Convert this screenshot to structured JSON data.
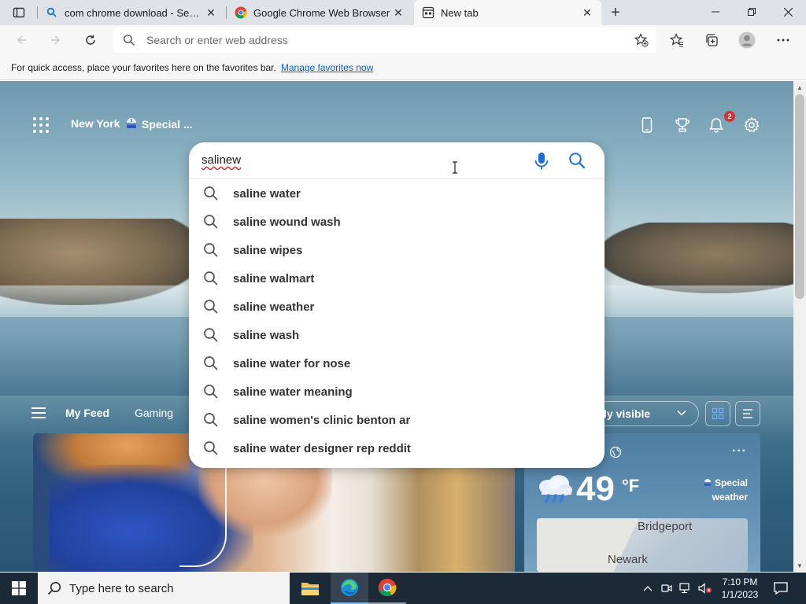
{
  "tabs": [
    {
      "title": "com chrome download - Search",
      "icon": "bing-search-icon",
      "active": false
    },
    {
      "title": "Google Chrome Web Browser",
      "icon": "chrome-icon",
      "active": false
    },
    {
      "title": "New tab",
      "icon": "edge-newtab-icon",
      "active": true
    }
  ],
  "toolbar": {
    "address_placeholder": "Search or enter web address"
  },
  "favorites_bar": {
    "message": "For quick access, place your favorites here on the favorites bar.",
    "link": "Manage favorites now"
  },
  "ntp": {
    "location": "New York",
    "special": "Special ...",
    "notification_count": "2"
  },
  "search": {
    "query": "salinew",
    "suggestions": [
      "saline water",
      "saline wound wash",
      "saline wipes",
      "saline walmart",
      "saline weather",
      "saline wash",
      "saline water for nose",
      "saline water meaning",
      "saline women's clinic benton ar",
      "saline water designer rep reddit"
    ]
  },
  "feed": {
    "tabs": [
      "My Feed",
      "Gaming"
    ],
    "visibility": "ly visible"
  },
  "weather": {
    "temperature": "49",
    "unit": "°F",
    "alert_line1": "Special",
    "alert_line2": "weather",
    "map_city1": "Bridgeport",
    "map_city2": "Newark"
  },
  "taskbar": {
    "search_placeholder": "Type here to search",
    "time": "7:10 PM",
    "date": "1/1/2023"
  },
  "colors": {
    "link": "#0f5fc7",
    "badge": "#d13438",
    "taskbar": "#1c2a38"
  }
}
